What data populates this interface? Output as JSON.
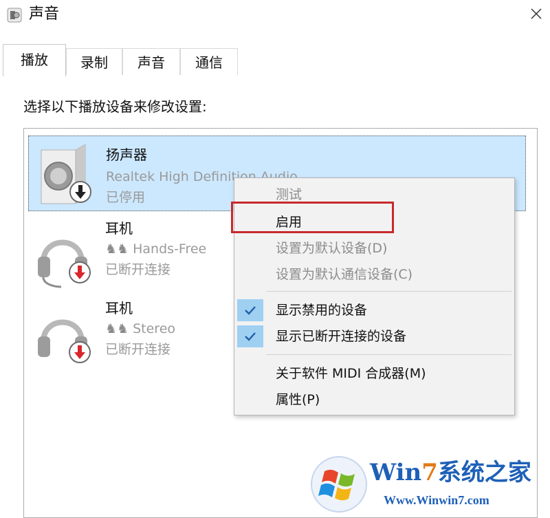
{
  "window": {
    "title": "声音",
    "icon": "speaker-icon",
    "close_icon": "close-icon"
  },
  "tabs": [
    {
      "label": "播放",
      "active": true
    },
    {
      "label": "录制",
      "active": false
    },
    {
      "label": "声音",
      "active": false
    },
    {
      "label": "通信",
      "active": false
    }
  ],
  "panel": {
    "instruction": "选择以下播放设备来修改设置:"
  },
  "devices": [
    {
      "name": "扬声器",
      "subtitle": "Realtek High Definition Audio",
      "status": "已停用",
      "icon": "speaker-device-icon",
      "badge": "disabled-arrow-icon",
      "selected": true
    },
    {
      "name": "耳机",
      "subtitle": "Hands-Free",
      "status": "已断开连接",
      "icon": "headphones-icon",
      "badge": "disconnected-arrow-icon",
      "selected": false
    },
    {
      "name": "耳机",
      "subtitle": "Stereo",
      "status": "已断开连接",
      "icon": "headphones-icon",
      "badge": "disconnected-arrow-icon",
      "selected": false
    }
  ],
  "context_menu": {
    "items": [
      {
        "label": "测试",
        "enabled": false,
        "checked": false
      },
      {
        "label": "启用",
        "enabled": true,
        "checked": false,
        "highlighted": true
      },
      {
        "label": "设置为默认设备(D)",
        "enabled": false,
        "checked": false
      },
      {
        "label": "设置为默认通信设备(C)",
        "enabled": false,
        "checked": false
      },
      {
        "label": "显示禁用的设备",
        "enabled": true,
        "checked": true
      },
      {
        "label": "显示已断开连接的设备",
        "enabled": true,
        "checked": true
      },
      {
        "label": "关于软件 MIDI 合成器(M)",
        "enabled": true,
        "checked": false
      },
      {
        "label": "属性(P)",
        "enabled": true,
        "checked": false
      }
    ]
  },
  "watermark": {
    "title_prefix": "Win",
    "title_accent": "7",
    "title_suffix": "系统之家",
    "url": "Www.Winwin7.com"
  },
  "colors": {
    "selection": "#cce8ff",
    "menu_background": "#f2f2f2",
    "check_background": "#9fd0f2",
    "highlight_border": "#c8282c",
    "badge_red": "#d9262b",
    "brand_blue": "#1e60b8"
  }
}
